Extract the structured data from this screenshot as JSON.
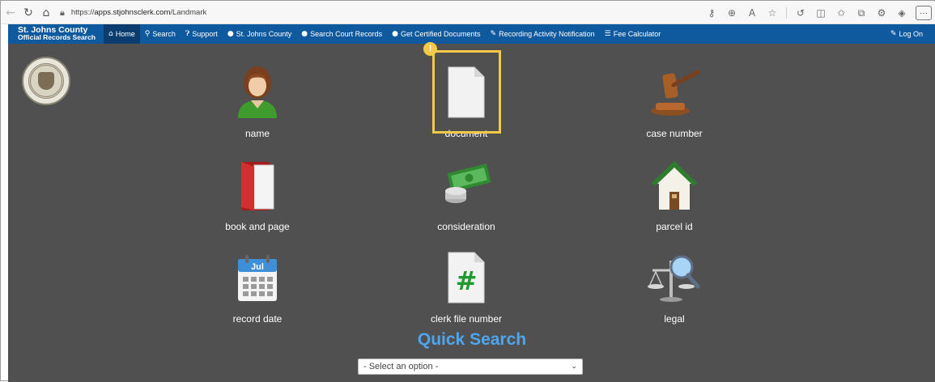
{
  "browser": {
    "url_prefix": "https://",
    "url_host": "apps.stjohnsclerk.com",
    "url_path": "/Landmark",
    "more_label": "···"
  },
  "site": {
    "brand_line1": "St. Johns County",
    "brand_line2": "Official Records Search",
    "nav": [
      {
        "label": "Home",
        "icon": "home-icon"
      },
      {
        "label": "Search",
        "icon": "search-icon"
      },
      {
        "label": "Support",
        "icon": "help-icon"
      },
      {
        "label": "St. Johns County",
        "icon": "globe-icon"
      },
      {
        "label": "Search Court Records",
        "icon": "globe-icon"
      },
      {
        "label": "Get Certified Documents",
        "icon": "globe-icon"
      },
      {
        "label": "Recording Activity Notification",
        "icon": "wrench-icon"
      },
      {
        "label": "Fee Calculator",
        "icon": "list-icon"
      }
    ],
    "login_label": "Log On"
  },
  "tiles": [
    {
      "label": "name",
      "icon": "person-icon"
    },
    {
      "label": "document",
      "icon": "document-icon"
    },
    {
      "label": "case number",
      "icon": "gavel-icon"
    },
    {
      "label": "book and page",
      "icon": "book-icon"
    },
    {
      "label": "consideration",
      "icon": "money-icon"
    },
    {
      "label": "parcel id",
      "icon": "house-icon"
    },
    {
      "label": "record date",
      "icon": "calendar-icon"
    },
    {
      "label": "clerk file number",
      "icon": "hash-icon"
    },
    {
      "label": "legal",
      "icon": "scales-icon"
    }
  ],
  "calendar_month": "Jul",
  "hash_symbol": "#",
  "highlight_badge": "!",
  "quick_search": {
    "title": "Quick Search",
    "selected": "- Select an option -"
  },
  "colors": {
    "nav_bg": "#0f5a9e",
    "nav_active": "#0a3d6e",
    "main_bg": "#505050",
    "highlight": "#f4c94a",
    "quick_search_title": "#4ea5f0"
  }
}
